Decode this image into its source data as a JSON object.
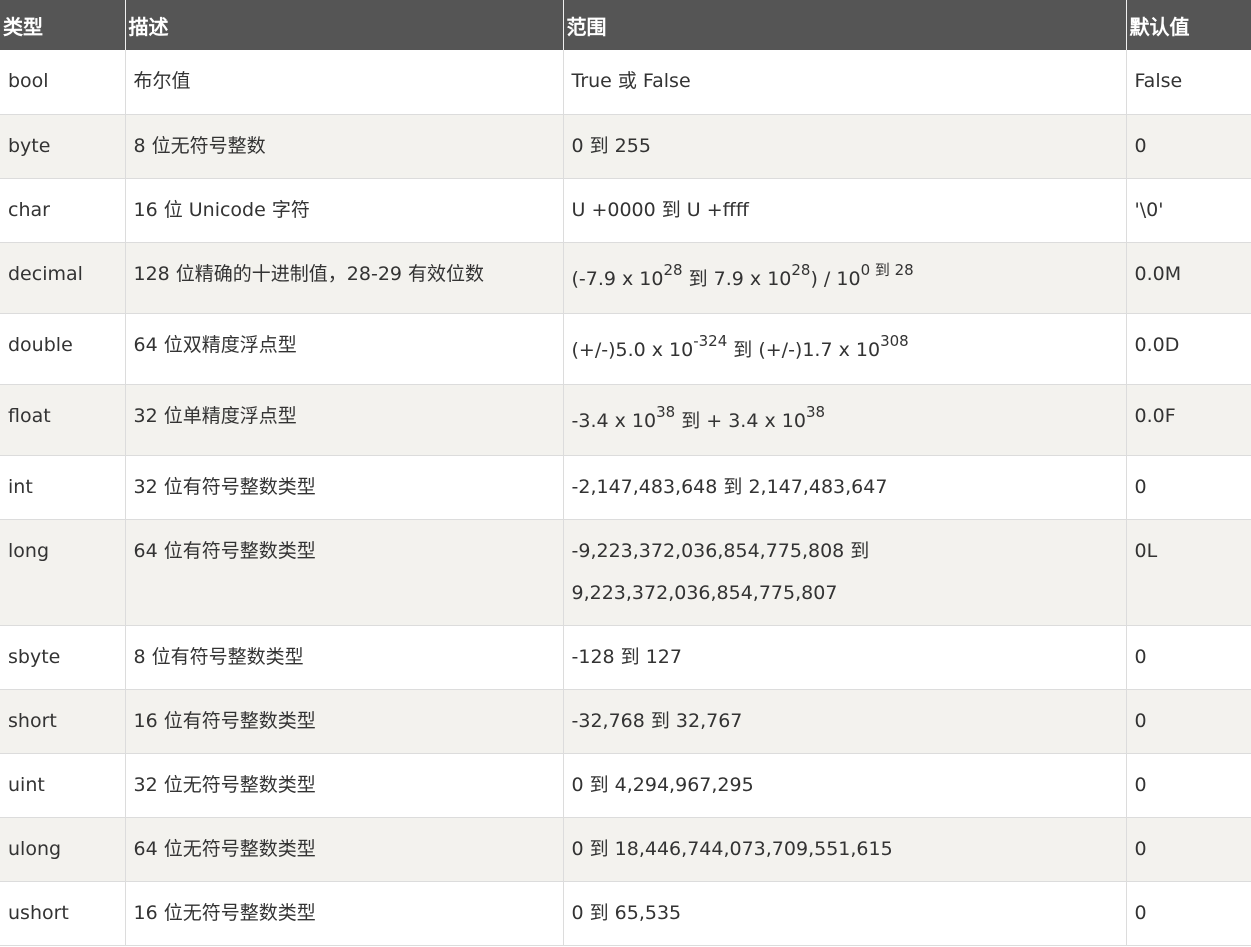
{
  "headers": {
    "type": "类型",
    "desc": "描述",
    "range": "范围",
    "default": "默认值"
  },
  "rows": [
    {
      "type": "bool",
      "desc": "布尔值",
      "range": "True 或 False",
      "default": "False"
    },
    {
      "type": "byte",
      "desc": "8 位无符号整数",
      "range": "0 到 255",
      "default": "0"
    },
    {
      "type": "char",
      "desc": "16 位 Unicode 字符",
      "range": "U +0000 到 U +ffff",
      "default": "'\\0'"
    },
    {
      "type": "decimal",
      "desc": "128 位精确的十进制值，28-29 有效位数",
      "range_parts": {
        "p1": "(-7.9 x 10",
        "s1": "28",
        "p2": " 到 7.9 x 10",
        "s2": "28",
        "p3": ") / 10",
        "s3": "0 到 28"
      },
      "default": "0.0M"
    },
    {
      "type": "double",
      "desc": "64 位双精度浮点型",
      "range_parts": {
        "p1": "(+/-)5.0 x 10",
        "s1": "-324",
        "p2": " 到 (+/-)1.7 x 10",
        "s2": "308"
      },
      "default": "0.0D"
    },
    {
      "type": "float",
      "desc": "32 位单精度浮点型",
      "range_parts": {
        "p1": "-3.4 x 10",
        "s1": "38",
        "p2": " 到 + 3.4 x 10",
        "s2": "38"
      },
      "default": "0.0F"
    },
    {
      "type": "int",
      "desc": "32 位有符号整数类型",
      "range": "-2,147,483,648 到 2,147,483,647",
      "default": "0"
    },
    {
      "type": "long",
      "desc": "64 位有符号整数类型",
      "range_line1": "-9,223,372,036,854,775,808 到",
      "range_line2": "9,223,372,036,854,775,807",
      "default": "0L"
    },
    {
      "type": "sbyte",
      "desc": "8 位有符号整数类型",
      "range": "-128 到 127",
      "default": "0"
    },
    {
      "type": "short",
      "desc": "16 位有符号整数类型",
      "range": "-32,768 到 32,767",
      "default": "0"
    },
    {
      "type": "uint",
      "desc": "32 位无符号整数类型",
      "range": "0 到 4,294,967,295",
      "default": "0"
    },
    {
      "type": "ulong",
      "desc": "64 位无符号整数类型",
      "range": "0 到 18,446,744,073,709,551,615",
      "default": "0"
    },
    {
      "type": "ushort",
      "desc": "16 位无符号整数类型",
      "range": "0 到 65,535",
      "default": "0"
    }
  ]
}
